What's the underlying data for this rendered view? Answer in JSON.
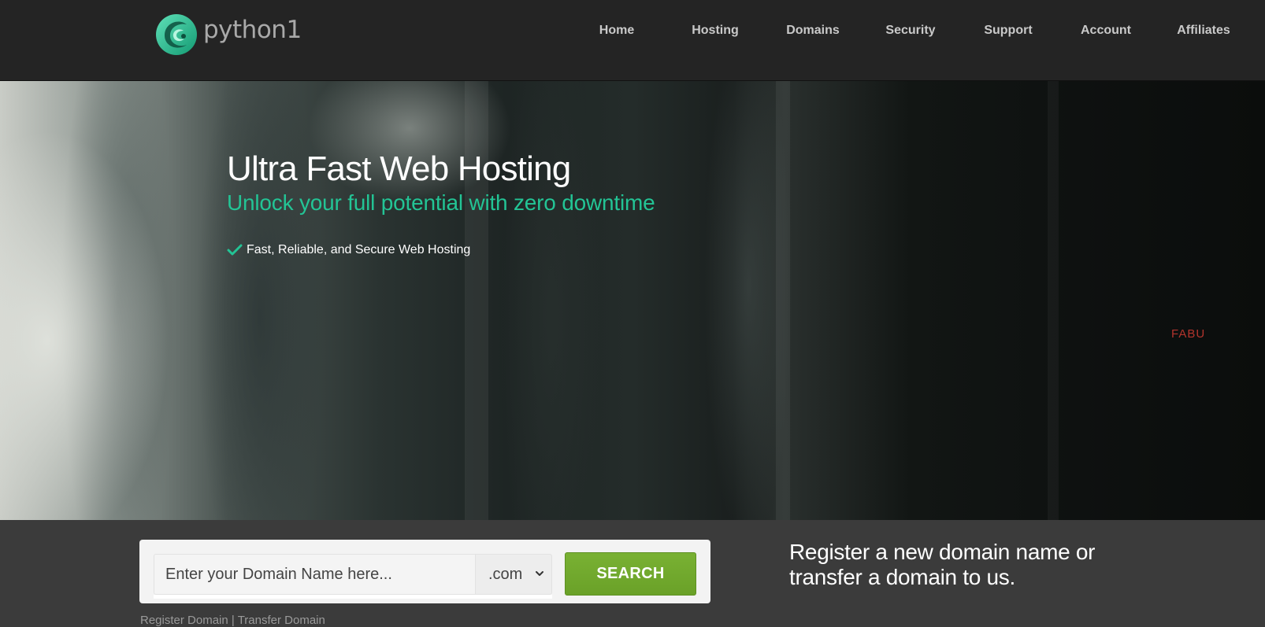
{
  "brand": {
    "name": "python1",
    "accent_color": "#23c495"
  },
  "nav": {
    "items": [
      {
        "label": "Home"
      },
      {
        "label": "Hosting"
      },
      {
        "label": "Domains"
      },
      {
        "label": "Security"
      },
      {
        "label": "Support"
      },
      {
        "label": "Account"
      },
      {
        "label": "Affiliates"
      }
    ]
  },
  "hero": {
    "title": "Ultra Fast Web Hosting",
    "subtitle": "Unlock your full potential with zero downtime",
    "feature": "Fast, Reliable, and Secure Web Hosting",
    "feature_icon": "check-icon",
    "watermark": "FABU"
  },
  "domain_search": {
    "placeholder": "Enter your Domain Name here...",
    "value": "",
    "tld_selected": ".com",
    "button_label": "SEARCH",
    "button_color": "#6fa82c",
    "links": {
      "register": "Register Domain",
      "separator": " | ",
      "transfer": "Transfer Domain"
    },
    "promo": "Register a new domain name or transfer a domain to us."
  }
}
